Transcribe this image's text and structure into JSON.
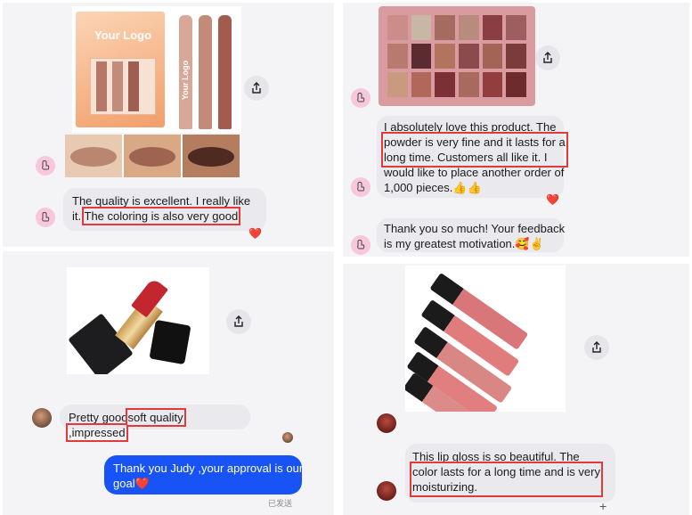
{
  "panel1": {
    "product_logo_text": "Your Logo",
    "pencil_logo_text": "Your Logo",
    "message_line1": "The quality is excellent. I really like",
    "message_line2_prefix": "it.",
    "message_highlight": "The coloring is also very good",
    "reaction": "❤️"
  },
  "panel2": {
    "message_line1": "I absolutely love this product. The",
    "message_highlight_line1": "powder is very fine and it lasts for a",
    "message_highlight_line2": "long time. Customers all like it. I",
    "message_line4": "would like to place another order of",
    "message_line5": "1,000 pieces.👍👍",
    "reaction": "❤️",
    "reply_line1": "Thank you so much! Your feedback",
    "reply_line2": "is my greatest motivation.🥰✌️"
  },
  "panel3": {
    "message_prefix": "Pretty good",
    "message_highlight": "soft quality ,impressed",
    "reply_line1": "Thank you Judy ,your approval is our",
    "reply_line2": "goal❤️",
    "sent_status": "已发送"
  },
  "panel4": {
    "message_line1": "This lip gloss is so beautiful. The",
    "message_highlight_line1": "color lasts for a long time and is very",
    "message_highlight_line2": "moisturizing.",
    "add_reaction": "+"
  },
  "colors": {
    "highlight": "#e23a3a",
    "outgoing_bubble": "#1753f5",
    "incoming_bubble": "#e9e9ee",
    "heart": "#e8324a"
  },
  "icons": [
    "share-icon",
    "heart-icon",
    "user-avatar-icon",
    "plus-icon"
  ]
}
